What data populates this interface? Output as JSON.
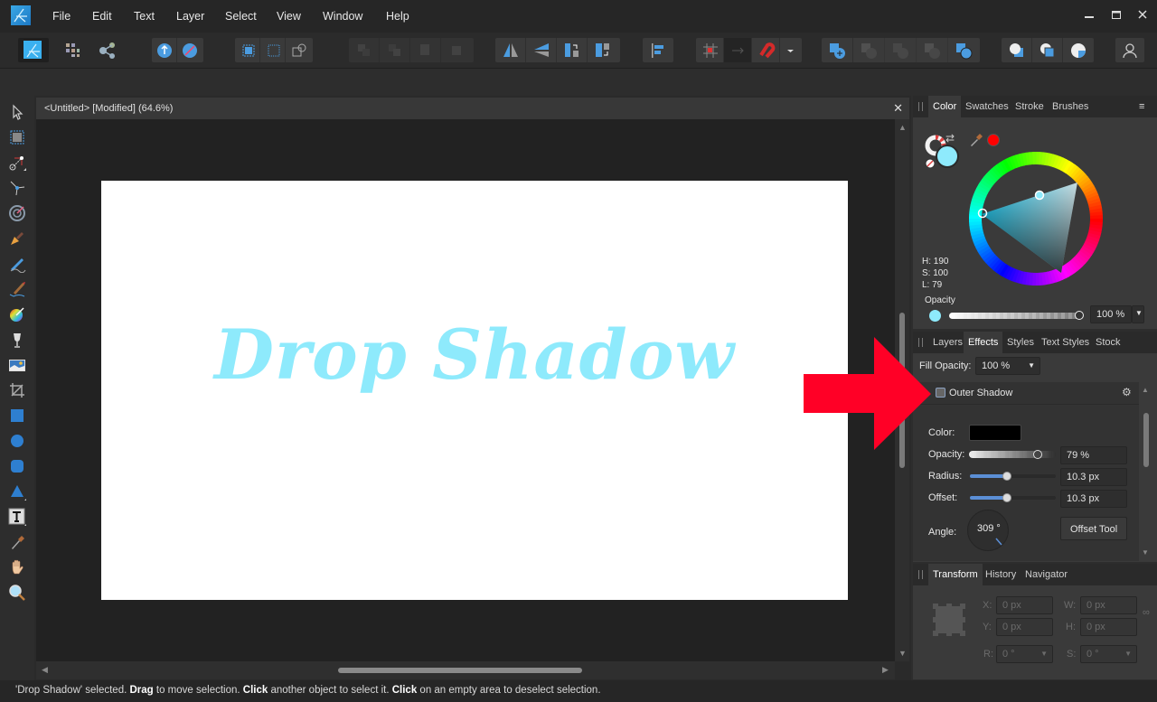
{
  "app": {
    "name": "Affinity Designer"
  },
  "menu": [
    "File",
    "Edit",
    "Text",
    "Layer",
    "Select",
    "View",
    "Window",
    "Help"
  ],
  "window_controls": {
    "minimize": "minimize-icon",
    "maximize": "maximize-icon",
    "close": "close-icon"
  },
  "toolbar": {
    "groups": [
      [
        "designer-persona-icon"
      ],
      [
        "pixel-persona-icon"
      ],
      [
        "export-persona-icon"
      ],
      [
        "isolate-icon",
        "no-isolate-icon"
      ],
      [
        "select-grid-icon",
        "select-dotted-icon",
        "select-objects-icon"
      ],
      [
        "back-one-icon",
        "forward-one-icon",
        "to-back-icon",
        "to-front-icon"
      ],
      [
        "flip-horizontal-icon",
        "flip-vertical-icon",
        "rotate-left-icon",
        "rotate-right-icon"
      ],
      [
        "align-icon"
      ],
      [
        "snapping-grid-icon",
        "snap-arrow-icon",
        "snapping-magnet-icon",
        "snapping-dropdown-icon"
      ],
      [
        "add-icon",
        "subtract-icon",
        "intersect-icon",
        "xor-icon",
        "divide-icon"
      ],
      [
        "insert-behind-icon",
        "insert-top-icon",
        "insert-inside-icon"
      ],
      [
        "user-icon"
      ]
    ]
  },
  "tools": [
    "move-tool-icon",
    "artboard-tool-icon",
    "node-tool-icon",
    "corner-tool-icon",
    "point-transform-tool-icon",
    "pen-tool-icon",
    "pencil-tool-icon",
    "vector-brush-tool-icon",
    "fill-tool-icon",
    "transparency-tool-icon",
    "place-image-tool-icon",
    "crop-tool-icon",
    "rectangle-tool-icon",
    "ellipse-tool-icon",
    "rounded-rectangle-tool-icon",
    "triangle-tool-icon",
    "artistic-text-tool-icon",
    "color-picker-tool-icon",
    "view-tool-icon",
    "zoom-tool-icon"
  ],
  "document": {
    "title": "<Untitled> [Modified] (64.6%)",
    "artboard_text": "Drop Shadow",
    "text_color": "#8eeafc"
  },
  "color_panel": {
    "tabs": [
      "Color",
      "Swatches",
      "Stroke",
      "Brushes"
    ],
    "active_tab": "Color",
    "hsl": {
      "h": "H: 190",
      "s": "S: 100",
      "l": "L: 79"
    },
    "fill_color": "#8eeafc",
    "recent_color": "#ff0000",
    "opacity_label": "Opacity",
    "opacity_value": "100 %"
  },
  "effects_panel": {
    "tabs": [
      "Layers",
      "Effects",
      "Styles",
      "Text Styles",
      "Stock"
    ],
    "active_tab": "Effects",
    "fill_opacity_label": "Fill Opacity:",
    "fill_opacity_value": "100 %",
    "effect_name": "Outer Shadow",
    "effect_enabled": false,
    "color_label": "Color:",
    "shadow_color": "#000000",
    "opacity_label": "Opacity:",
    "opacity_value": "79 %",
    "opacity_fraction": 0.79,
    "radius_label": "Radius:",
    "radius_value": "10.3 px",
    "offset_label": "Offset:",
    "offset_value": "10.3 px",
    "angle_label": "Angle:",
    "angle_value": "309 °",
    "offset_tool_label": "Offset Tool"
  },
  "transform_panel": {
    "tabs": [
      "Transform",
      "History",
      "Navigator"
    ],
    "active_tab": "Transform",
    "x_label": "X:",
    "x_value": "0 px",
    "y_label": "Y:",
    "y_value": "0 px",
    "w_label": "W:",
    "w_value": "0 px",
    "h_label": "H:",
    "h_value": "0 px",
    "r_label": "R:",
    "r_value": "0 °",
    "s_label": "S:",
    "s_value": "0 °"
  },
  "status": {
    "parts": [
      {
        "text": "'Drop Shadow' selected. ",
        "bold": false
      },
      {
        "text": "Drag",
        "bold": true
      },
      {
        "text": " to move selection. ",
        "bold": false
      },
      {
        "text": "Click",
        "bold": true
      },
      {
        "text": " another object to select it. ",
        "bold": false
      },
      {
        "text": "Click",
        "bold": true
      },
      {
        "text": " on an empty area to deselect selection.",
        "bold": false
      }
    ]
  },
  "annotation": {
    "type": "arrow",
    "color": "#ff0026",
    "points_to": "Outer Shadow checkbox"
  }
}
